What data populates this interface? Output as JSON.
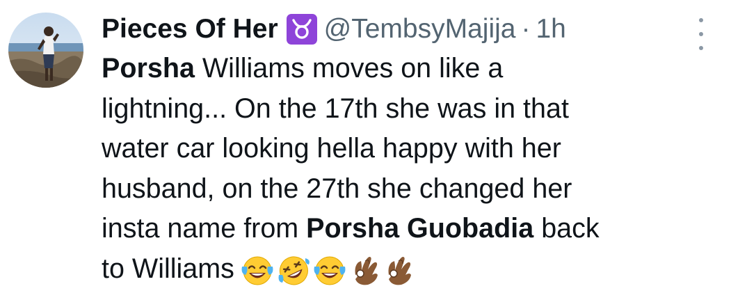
{
  "tweet": {
    "display_name": "Pieces Of Her",
    "zodiac_badge": "♉",
    "handle": "@TembsyMajija",
    "separator": "·",
    "time": "1h",
    "text": {
      "line1_bold": "Porsha",
      "line1_rest": " Williams moves on like a",
      "line2": "lightning... On the 17th she was in that",
      "line3": "water car looking hella happy with her",
      "line4": "husband, on the 27th she changed her",
      "line5_start": "insta name from ",
      "line5_bold": "Porsha Guobadia",
      "line5_end": " back",
      "line6": "to Williams"
    },
    "emojis": [
      "joy-emoji",
      "rofl-emoji",
      "joy-emoji",
      "ok-hand-emoji",
      "ok-hand-emoji"
    ]
  },
  "colors": {
    "text": "#0f1419",
    "secondary": "#536471",
    "badge": "#8e44d9",
    "more_dots": "#8b98a5"
  }
}
